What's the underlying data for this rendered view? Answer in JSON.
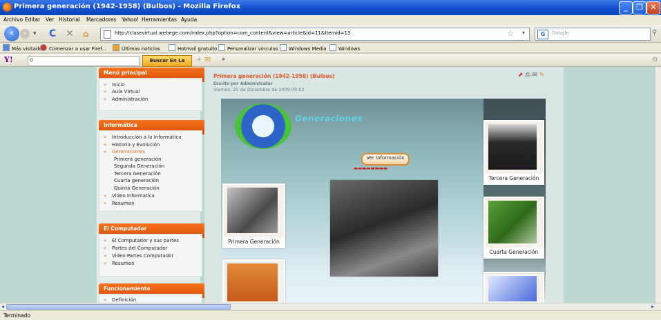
{
  "window": {
    "title": "Primera generación (1942-1958) (Bulbos) - Mozilla Firefox"
  },
  "menu": [
    "Archivo",
    "Editar",
    "Ver",
    "Historial",
    "Marcadores",
    "Yahoo!",
    "Herramientas",
    "Ayuda"
  ],
  "address": {
    "url": "http://clasevirtual.webege.com/index.php?option=com_content&view=article&id=11&Itemid=13"
  },
  "search": {
    "engine": "G",
    "placeholder": "Google"
  },
  "bookmarks": [
    "Más visitados",
    "Comenzar a usar Firef...",
    "Últimas noticias",
    "Hotmail gratuito",
    "Personalizar vínculos",
    "Windows Media",
    "Windows"
  ],
  "yahoo": {
    "logo": "Y!",
    "button": "Buscar En La Web",
    "input_value": "o"
  },
  "sidebar": {
    "modules": [
      {
        "title": "Menú principal",
        "items": [
          "Inicio",
          "Aula Virtual",
          "Administración"
        ]
      },
      {
        "title": "Informática",
        "items": [
          "Introducción a la Informática",
          "Historia y Evolución",
          "Generaciones"
        ],
        "subitems": [
          "Primera generación",
          "Segunda Generación",
          "Tercera Generación",
          "Cuarta generación",
          "Quinta Generación"
        ],
        "items_after": [
          "Video Informatica",
          "Resumen"
        ]
      },
      {
        "title": "El Computador",
        "items": [
          "El Computador y sus partes",
          "Partes del Computador",
          "Video Partes Computador",
          "Resumen"
        ]
      },
      {
        "title": "Funcionamiento",
        "items": [
          "Definición"
        ]
      }
    ]
  },
  "article": {
    "title": "Primera generación (1942-1958) (Bulbos)",
    "author": "Escrito por Administrator",
    "date": "Viernes, 25 de Diciembre de 2009 09:02"
  },
  "flash": {
    "logo_text": "Generaciones",
    "button": "Ver Información",
    "captions": [
      "Primera Generación",
      "Tercera Generación",
      "Cuarta Generación"
    ]
  },
  "status": {
    "text": "Terminado"
  }
}
